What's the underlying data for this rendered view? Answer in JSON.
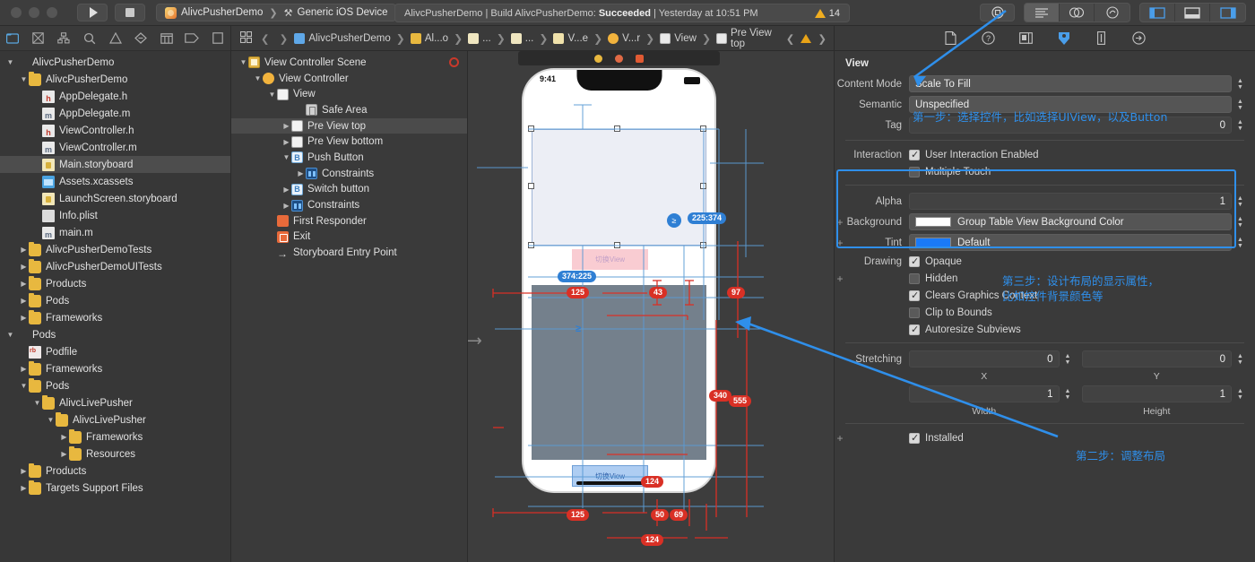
{
  "titlebar": {
    "run_label": "Run",
    "stop_label": "Stop",
    "scheme_project": "AlivcPusherDemo",
    "scheme_device": "Generic iOS Device",
    "status_text_1": "AlivcPusherDemo | Build AlivcPusherDemo: ",
    "status_bold": "Succeeded",
    "status_text_2": " | Yesterday at 10:51 PM",
    "warning_count": "14",
    "right_icons": [
      "library-icon",
      "standard-editor-icon",
      "assistant-editor-icon",
      "version-editor-icon",
      "navigator-toggle-icon",
      "debug-toggle-icon",
      "inspector-toggle-icon"
    ]
  },
  "navigator": {
    "toolbar_icons": [
      "project-navigator-icon",
      "source-control-icon",
      "symbol-navigator-icon",
      "find-navigator-icon",
      "issue-navigator-icon",
      "test-navigator-icon",
      "debug-navigator-icon",
      "breakpoint-navigator-icon",
      "report-navigator-icon"
    ],
    "items": [
      {
        "label": "AlivcPusherDemo",
        "indent": 0,
        "icon": "project",
        "disc": "down"
      },
      {
        "label": "AlivcPusherDemo",
        "indent": 1,
        "icon": "folder",
        "disc": "down"
      },
      {
        "label": "AppDelegate.h",
        "indent": 2,
        "icon": "h",
        "disc": ""
      },
      {
        "label": "AppDelegate.m",
        "indent": 2,
        "icon": "m",
        "disc": ""
      },
      {
        "label": "ViewController.h",
        "indent": 2,
        "icon": "h",
        "disc": ""
      },
      {
        "label": "ViewController.m",
        "indent": 2,
        "icon": "m",
        "disc": ""
      },
      {
        "label": "Main.storyboard",
        "indent": 2,
        "icon": "sb",
        "disc": "",
        "selected": true
      },
      {
        "label": "Assets.xcassets",
        "indent": 2,
        "icon": "xc",
        "disc": ""
      },
      {
        "label": "LaunchScreen.storyboard",
        "indent": 2,
        "icon": "sb",
        "disc": ""
      },
      {
        "label": "Info.plist",
        "indent": 2,
        "icon": "plist",
        "disc": ""
      },
      {
        "label": "main.m",
        "indent": 2,
        "icon": "m",
        "disc": ""
      },
      {
        "label": "AlivcPusherDemoTests",
        "indent": 1,
        "icon": "folder",
        "disc": "right"
      },
      {
        "label": "AlivcPusherDemoUITests",
        "indent": 1,
        "icon": "folder",
        "disc": "right"
      },
      {
        "label": "Products",
        "indent": 1,
        "icon": "folder",
        "disc": "right"
      },
      {
        "label": "Pods",
        "indent": 1,
        "icon": "folder",
        "disc": "right"
      },
      {
        "label": "Frameworks",
        "indent": 1,
        "icon": "folder",
        "disc": "right"
      },
      {
        "label": "Pods",
        "indent": 0,
        "icon": "project",
        "disc": "down"
      },
      {
        "label": "Podfile",
        "indent": 1,
        "icon": "rb",
        "disc": ""
      },
      {
        "label": "Frameworks",
        "indent": 1,
        "icon": "folder",
        "disc": "right"
      },
      {
        "label": "Pods",
        "indent": 1,
        "icon": "folder",
        "disc": "down"
      },
      {
        "label": "AlivcLivePusher",
        "indent": 2,
        "icon": "folder",
        "disc": "down"
      },
      {
        "label": "AlivcLivePusher",
        "indent": 3,
        "icon": "folder",
        "disc": "down"
      },
      {
        "label": "Frameworks",
        "indent": 4,
        "icon": "folder",
        "disc": "right"
      },
      {
        "label": "Resources",
        "indent": 4,
        "icon": "folder",
        "disc": "right"
      },
      {
        "label": "Products",
        "indent": 1,
        "icon": "folder",
        "disc": "right"
      },
      {
        "label": "Targets Support Files",
        "indent": 1,
        "icon": "folder",
        "disc": "right"
      }
    ]
  },
  "jumpbar": {
    "back_label": "Back",
    "forward_label": "Forward",
    "crumbs": [
      {
        "label": "AlivcPusherDemo",
        "icon": "proj"
      },
      {
        "label": "Al...o",
        "icon": "folder"
      },
      {
        "label": "...",
        "icon": "doc"
      },
      {
        "label": "...",
        "icon": "doc"
      },
      {
        "label": "V...e",
        "icon": "sb"
      },
      {
        "label": "V...r",
        "icon": "vc"
      },
      {
        "label": "View",
        "icon": "view"
      },
      {
        "label": "Pre View top",
        "icon": "view"
      }
    ]
  },
  "outline": {
    "items": [
      {
        "label": "View Controller Scene",
        "indent": 0,
        "icon": "scene",
        "disc": "down",
        "error": true
      },
      {
        "label": "View Controller",
        "indent": 1,
        "icon": "vc",
        "disc": "down"
      },
      {
        "label": "View",
        "indent": 2,
        "icon": "view",
        "disc": "down"
      },
      {
        "label": "Safe Area",
        "indent": 4,
        "icon": "safe",
        "disc": ""
      },
      {
        "label": "Pre View top",
        "indent": 3,
        "icon": "view",
        "disc": "right",
        "selected": true
      },
      {
        "label": "Pre View bottom",
        "indent": 3,
        "icon": "view",
        "disc": "right"
      },
      {
        "label": "Push Button",
        "indent": 3,
        "icon": "btn",
        "disc": "down",
        "glyph": "B"
      },
      {
        "label": "Constraints",
        "indent": 4,
        "icon": "cons",
        "disc": "right"
      },
      {
        "label": "Switch button",
        "indent": 3,
        "icon": "btn",
        "disc": "right",
        "glyph": "B"
      },
      {
        "label": "Constraints",
        "indent": 3,
        "icon": "cons",
        "disc": "right"
      },
      {
        "label": "First Responder",
        "indent": 2,
        "icon": "fr",
        "disc": ""
      },
      {
        "label": "Exit",
        "indent": 2,
        "icon": "exit",
        "disc": ""
      },
      {
        "label": "Storyboard Entry Point",
        "indent": 2,
        "icon": "arrow",
        "disc": ""
      }
    ]
  },
  "canvas": {
    "status_time": "9:41",
    "top_label": "225:374",
    "mid_label": "374:225",
    "button_top_text": "切换View",
    "button_bottom_text": "切换View",
    "measurements": [
      "125",
      "43",
      "97",
      "340",
      "555",
      "124",
      "125",
      "50",
      "69",
      "124"
    ],
    "dot_colors": [
      "#e8b83f",
      "#e06a45",
      "#e05a33"
    ]
  },
  "inspector": {
    "tabs": [
      "file-inspector-icon",
      "quick-help-icon",
      "identity-inspector-icon",
      "attributes-inspector-icon",
      "size-inspector-icon",
      "connections-inspector-icon"
    ],
    "section_title": "View",
    "content_mode_label": "Content Mode",
    "content_mode_value": "Scale To Fill",
    "semantic_label": "Semantic",
    "semantic_value": "Unspecified",
    "tag_label": "Tag",
    "tag_value": "0",
    "interaction_label": "Interaction",
    "user_interaction_label": "User Interaction Enabled",
    "multiple_touch_label": "Multiple Touch",
    "alpha_label": "Alpha",
    "alpha_value": "1",
    "background_label": "Background",
    "background_value": "Group Table View Background Color",
    "background_swatch": "#ffffff",
    "tint_label": "Tint",
    "tint_value": "Default",
    "tint_swatch": "#1a7af8",
    "drawing_label": "Drawing",
    "opaque_label": "Opaque",
    "hidden_label": "Hidden",
    "clears_label": "Clears Graphics Context",
    "clip_label": "Clip to Bounds",
    "autoresize_label": "Autoresize Subviews",
    "stretching_label": "Stretching",
    "stretch_x": "0",
    "stretch_y": "0",
    "stretch_w": "1",
    "stretch_h": "1",
    "sub_x": "X",
    "sub_y": "Y",
    "sub_w": "Width",
    "sub_h": "Height",
    "installed_label": "Installed"
  },
  "annotations": {
    "step1": "第一步：选择控件，比如选择UIView，以及Button",
    "step3_line1": "第三步：设计布局的显示属性，",
    "step3_line2": "比如控件背景颜色等",
    "step2": "第二步：调整布局",
    "accent": "#2f8fea"
  }
}
